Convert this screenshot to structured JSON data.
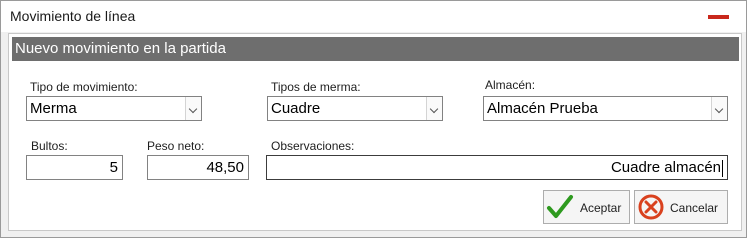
{
  "window": {
    "title": "Movimiento de línea"
  },
  "section": {
    "header": "Nuevo movimiento en la partida"
  },
  "fields": {
    "tipo_movimiento": {
      "label": "Tipo de movimiento:",
      "value": "Merma"
    },
    "tipos_merma": {
      "label": "Tipos de merma:",
      "value": "Cuadre"
    },
    "almacen": {
      "label": "Almacén:",
      "value": "Almacén Prueba"
    },
    "bultos": {
      "label": "Bultos:",
      "value": "5"
    },
    "peso_neto": {
      "label": "Peso neto:",
      "value": "48,50"
    },
    "observaciones": {
      "label": "Observaciones:",
      "value": "Cuadre almacén"
    }
  },
  "buttons": {
    "aceptar": {
      "label": "Aceptar",
      "icon": "checkmark-icon"
    },
    "cancelar": {
      "label": "Cancelar",
      "icon": "cancel-icon"
    }
  },
  "colors": {
    "header_bg": "#6e6e6e",
    "close_button": "#c9281c",
    "accept_icon": "#2e9a1f",
    "cancel_icon": "#d9411e"
  }
}
